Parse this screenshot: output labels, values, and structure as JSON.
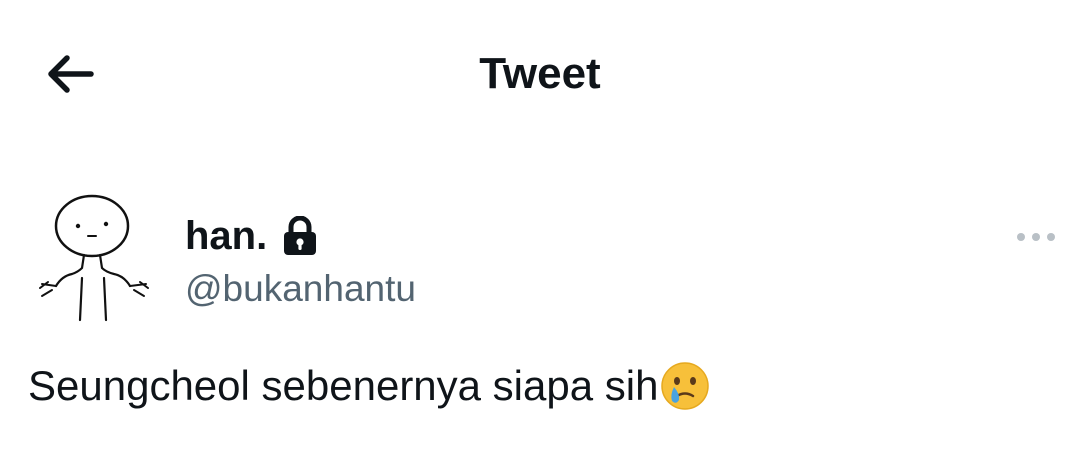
{
  "header": {
    "title": "Tweet",
    "back_icon": "arrow-left-icon"
  },
  "author": {
    "display_name": "han.",
    "handle": "@bukanhantu",
    "protected_icon": "lock-icon",
    "avatar": "shrugging-stick-figure-avatar"
  },
  "more_icon": "more-horizontal-icon",
  "tweet": {
    "text": "Seungcheol sebenernya siapa sih",
    "emoji_icon": "face-holding-back-tears-icon"
  },
  "colors": {
    "text": "#0f1419",
    "secondary": "#536471",
    "more_dots": "#b9c0c6",
    "emoji_face": "#f7c03a",
    "emoji_tear": "#4aa3e0"
  }
}
